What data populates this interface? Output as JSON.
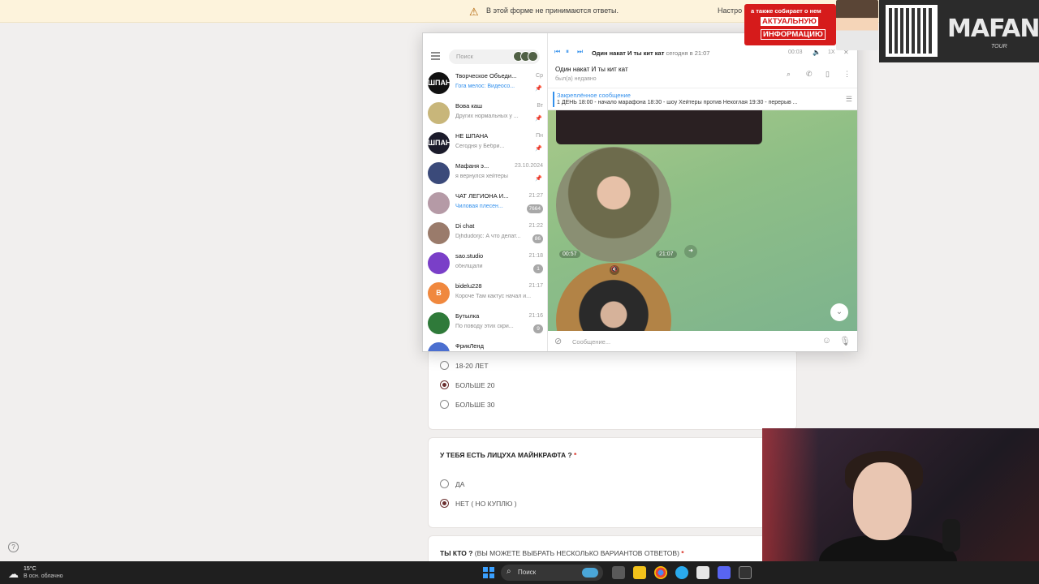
{
  "form": {
    "banner_text": "В этой форме не принимаются ответы.",
    "banner_settings": "Настро",
    "age_options": [
      {
        "label": "18-20 ЛЕТ",
        "selected": false
      },
      {
        "label": "БОЛЬШЕ 20",
        "selected": true
      },
      {
        "label": "БОЛЬШЕ 30",
        "selected": false
      }
    ],
    "q_license": {
      "title": "У ТЕБЯ ЕСТЬ ЛИЦУХА МАЙНКРАФТА ?",
      "required_mark": "*",
      "options": [
        {
          "label": "ДА",
          "selected": false
        },
        {
          "label": "НЕТ ( НО КУПЛЮ )",
          "selected": true
        }
      ]
    },
    "q_who": {
      "title": "ТЫ КТО ?",
      "subtitle": "(ВЫ МОЖЕТЕ ВЫБРАТЬ НЕСКОЛЬКО ВАРИАНТОВ ОТВЕТОВ)",
      "required_mark": "*"
    },
    "help_icon": "?"
  },
  "telegram": {
    "search_placeholder": "Поиск",
    "chats": [
      {
        "name": "Творческое Объеди...",
        "time": "Ср",
        "preview": "Гога мелос: Видеосо...",
        "preview_blue": true,
        "badge": "",
        "pinned": true,
        "avatar_text": "ШПАНА",
        "avatar_color": "#111111"
      },
      {
        "name": "Вова каш",
        "time": "Вт",
        "preview": "Других нормальных у ...",
        "preview_blue": false,
        "badge": "",
        "pinned": true,
        "avatar_text": "",
        "avatar_color": "#c8b67a"
      },
      {
        "name": "НЕ ШПАНА",
        "time": "Пн",
        "preview": "Сегодня у Бебри...",
        "preview_blue": false,
        "badge": "",
        "pinned": true,
        "avatar_text": "ШПАНА",
        "avatar_color": "#1b1b2b"
      },
      {
        "name": "Мафаня э...",
        "time": "23.10.2024",
        "preview": "я вернулся хейтеры",
        "preview_blue": false,
        "badge": "",
        "pinned": true,
        "avatar_text": "",
        "avatar_color": "#3b4a7a"
      },
      {
        "name": "ЧАТ ЛЕГИОНА И...",
        "time": "21:27",
        "preview": "Чиловая плесен...",
        "preview_blue": true,
        "badge": "7664",
        "pinned": false,
        "avatar_text": "",
        "avatar_color": "#b59aa6"
      },
      {
        "name": "Di chat",
        "time": "21:22",
        "preview": "Djhdudorjc: А что делат...",
        "preview_blue": false,
        "badge": "86",
        "pinned": false,
        "avatar_text": "",
        "avatar_color": "#9a7b6b"
      },
      {
        "name": "sao.studio",
        "time": "21:18",
        "preview": "обнлщали",
        "preview_blue": false,
        "badge": "1",
        "pinned": false,
        "avatar_text": "",
        "avatar_color": "#7a3fc8"
      },
      {
        "name": "bidelu228",
        "time": "21:17",
        "preview": "Короче Там кактус начал и...",
        "preview_blue": false,
        "badge": "",
        "pinned": false,
        "avatar_text": "B",
        "avatar_color": "#f0883e"
      },
      {
        "name": "Бутылка",
        "time": "21:16",
        "preview": "По поводу этих скри...",
        "preview_blue": false,
        "badge": "9",
        "pinned": false,
        "avatar_text": "",
        "avatar_color": "#2f7a3a"
      },
      {
        "name": "ФрикЛенд",
        "time": "",
        "preview": "",
        "preview_blue": false,
        "badge": "",
        "pinned": false,
        "avatar_text": "",
        "avatar_color": "#4b6fd0"
      }
    ],
    "player": {
      "track_title": "Один накат И ты кит кат",
      "track_time": "сегодня в 21:07",
      "elapsed": "00:03",
      "speed": "1X"
    },
    "chat_header": {
      "title": "Один накат И ты кит кат",
      "status": "был(а) недавно"
    },
    "pinned": {
      "label": "Закреплённое сообщение",
      "text": "1 ДЕНЬ 18:00 - начало марафона   18:30 - шоу Хейтеры против Некоглая   19:30 - перерыв ..."
    },
    "video1": {
      "duration": "00:57",
      "time": "21:07"
    },
    "compose_placeholder": "Сообщение..."
  },
  "overlays": {
    "promo_line1": "а также собирает о нем",
    "promo_line2": "АКТУАЛЬНУЮ",
    "promo_line3": "ИНФОРМАЦИЮ",
    "brand": "MAFANYA",
    "brand_sub": "TOUR"
  },
  "taskbar": {
    "temperature": "15°C",
    "weather": "В осн. облачно",
    "search_label": "Поиск"
  }
}
